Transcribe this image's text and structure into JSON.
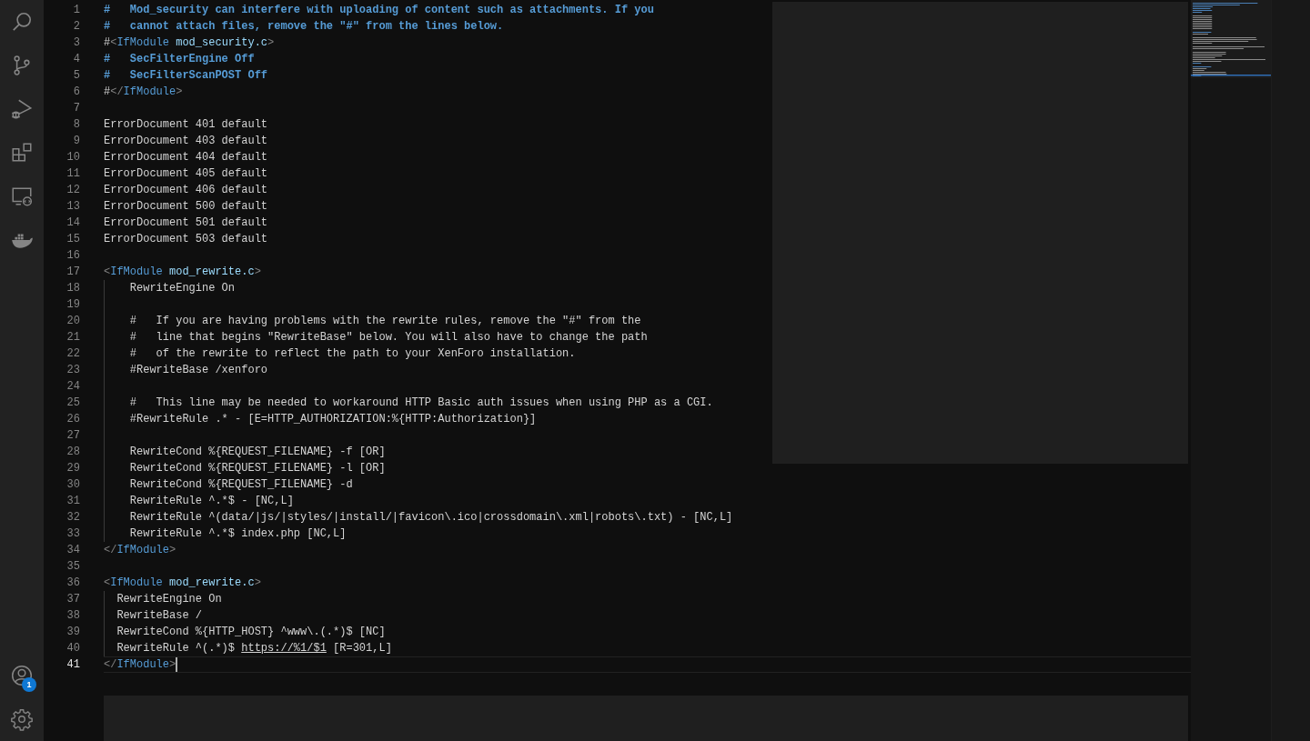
{
  "activity_bar": {
    "items": [
      {
        "kind": "search",
        "selected": false
      },
      {
        "kind": "source-control",
        "selected": false
      },
      {
        "kind": "run-debug",
        "selected": false
      },
      {
        "kind": "extensions",
        "selected": false
      },
      {
        "kind": "remote",
        "selected": false
      },
      {
        "kind": "docker",
        "selected": false
      }
    ],
    "account": {
      "badge": "1"
    }
  },
  "editor": {
    "lines": [
      {
        "number": "1",
        "tokens": [
          {
            "kind": "doc",
            "text": "#   Mod_security can interfere with uploading of content such as attachments. If you"
          }
        ]
      },
      {
        "number": "2",
        "tokens": [
          {
            "kind": "doc",
            "text": "#   cannot attach files, remove the \"#\" from the lines below."
          }
        ]
      },
      {
        "number": "3",
        "tokens": [
          {
            "kind": "text",
            "text": "#"
          },
          {
            "kind": "punct",
            "text": "<"
          },
          {
            "kind": "tag",
            "text": "IfModule"
          },
          {
            "kind": "attr",
            "text": " mod_security.c"
          },
          {
            "kind": "punct",
            "text": ">"
          }
        ]
      },
      {
        "number": "4",
        "tokens": [
          {
            "kind": "doc",
            "text": "#   SecFilterEngine Off"
          }
        ]
      },
      {
        "number": "5",
        "tokens": [
          {
            "kind": "doc",
            "text": "#   SecFilterScanPOST Off"
          }
        ]
      },
      {
        "number": "6",
        "tokens": [
          {
            "kind": "text",
            "text": "#"
          },
          {
            "kind": "punct",
            "text": "</"
          },
          {
            "kind": "tag",
            "text": "IfModule"
          },
          {
            "kind": "punct",
            "text": ">"
          }
        ]
      },
      {
        "number": "7"
      },
      {
        "number": "8",
        "tokens": [
          {
            "kind": "text",
            "text": "ErrorDocument 401 default"
          }
        ]
      },
      {
        "number": "9",
        "tokens": [
          {
            "kind": "text",
            "text": "ErrorDocument 403 default"
          }
        ]
      },
      {
        "number": "10",
        "tokens": [
          {
            "kind": "text",
            "text": "ErrorDocument 404 default"
          }
        ]
      },
      {
        "number": "11",
        "tokens": [
          {
            "kind": "text",
            "text": "ErrorDocument 405 default"
          }
        ]
      },
      {
        "number": "12",
        "tokens": [
          {
            "kind": "text",
            "text": "ErrorDocument 406 default"
          }
        ]
      },
      {
        "number": "13",
        "tokens": [
          {
            "kind": "text",
            "text": "ErrorDocument 500 default"
          }
        ]
      },
      {
        "number": "14",
        "tokens": [
          {
            "kind": "text",
            "text": "ErrorDocument 501 default"
          }
        ]
      },
      {
        "number": "15",
        "tokens": [
          {
            "kind": "text",
            "text": "ErrorDocument 503 default"
          }
        ]
      },
      {
        "number": "16"
      },
      {
        "number": "17",
        "tokens": [
          {
            "kind": "punct",
            "text": "<"
          },
          {
            "kind": "tag",
            "text": "IfModule"
          },
          {
            "kind": "attr",
            "text": " mod_rewrite.c"
          },
          {
            "kind": "punct",
            "text": ">"
          }
        ],
        "children": [
          {
            "number": "18",
            "tokens": [
              {
                "kind": "text",
                "text": "    RewriteEngine On"
              }
            ]
          },
          {
            "number": "19"
          },
          {
            "number": "20",
            "tokens": [
              {
                "kind": "text",
                "text": "    #   If you are having problems with the rewrite rules, remove the \"#\" from the"
              }
            ]
          },
          {
            "number": "21",
            "tokens": [
              {
                "kind": "text",
                "text": "    #   line that begins \"RewriteBase\" below. You will also have to change the path"
              }
            ]
          },
          {
            "number": "22",
            "tokens": [
              {
                "kind": "text",
                "text": "    #   of the rewrite to reflect the path to your XenForo installation."
              }
            ]
          },
          {
            "number": "23",
            "tokens": [
              {
                "kind": "text",
                "text": "    #RewriteBase /xenforo"
              }
            ]
          },
          {
            "number": "24"
          },
          {
            "number": "25",
            "tokens": [
              {
                "kind": "text",
                "text": "    #   This line may be needed to workaround HTTP Basic auth issues when using PHP as a CGI."
              }
            ]
          },
          {
            "number": "26",
            "tokens": [
              {
                "kind": "text",
                "text": "    #RewriteRule .* - [E=HTTP_AUTHORIZATION:%{HTTP:Authorization}]"
              }
            ]
          },
          {
            "number": "27"
          },
          {
            "number": "28",
            "tokens": [
              {
                "kind": "text",
                "text": "    RewriteCond %{REQUEST_FILENAME} -f [OR]"
              }
            ]
          },
          {
            "number": "29",
            "tokens": [
              {
                "kind": "text",
                "text": "    RewriteCond %{REQUEST_FILENAME} -l [OR]"
              }
            ]
          },
          {
            "number": "30",
            "tokens": [
              {
                "kind": "text",
                "text": "    RewriteCond %{REQUEST_FILENAME} -d"
              }
            ]
          },
          {
            "number": "31",
            "tokens": [
              {
                "kind": "text",
                "text": "    RewriteRule ^.*$ - [NC,L]"
              }
            ]
          },
          {
            "number": "32",
            "tokens": [
              {
                "kind": "text",
                "text": "    RewriteRule ^(data/|js/|styles/|install/|favicon\\.ico|crossdomain\\.xml|robots\\.txt) - [NC,L]"
              }
            ]
          },
          {
            "number": "33",
            "tokens": [
              {
                "kind": "text",
                "text": "    RewriteRule ^.*$ index.php [NC,L]"
              }
            ]
          }
        ]
      },
      {
        "number": "34",
        "tokens": [
          {
            "kind": "punct",
            "text": "</"
          },
          {
            "kind": "tag",
            "text": "IfModule"
          },
          {
            "kind": "punct",
            "text": ">"
          }
        ]
      },
      {
        "number": "35"
      },
      {
        "number": "36",
        "tokens": [
          {
            "kind": "punct",
            "text": "<"
          },
          {
            "kind": "tag",
            "text": "IfModule"
          },
          {
            "kind": "attr",
            "text": " mod_rewrite.c"
          },
          {
            "kind": "punct",
            "text": ">"
          }
        ],
        "children": [
          {
            "number": "37",
            "tokens": [
              {
                "kind": "text",
                "text": "  RewriteEngine On"
              }
            ]
          },
          {
            "number": "38",
            "tokens": [
              {
                "kind": "text",
                "text": "  RewriteBase /"
              }
            ]
          },
          {
            "number": "39",
            "tokens": [
              {
                "kind": "text",
                "text": "  RewriteCond %{HTTP_HOST} ^www\\.(.*)$ [NC]"
              }
            ]
          },
          {
            "number": "40",
            "tokens": [
              {
                "kind": "text",
                "text": "  RewriteRule ^(.*)$ "
              },
              {
                "kind": "link",
                "text": "https://%1/$1"
              },
              {
                "kind": "text",
                "text": " [R=301,L]"
              }
            ]
          }
        ]
      },
      {
        "number": "41",
        "current": true,
        "tokens": [
          {
            "kind": "punct",
            "text": "</"
          },
          {
            "kind": "tag",
            "text": "IfModule"
          },
          {
            "kind": "punct",
            "text": ">"
          }
        ]
      }
    ]
  }
}
